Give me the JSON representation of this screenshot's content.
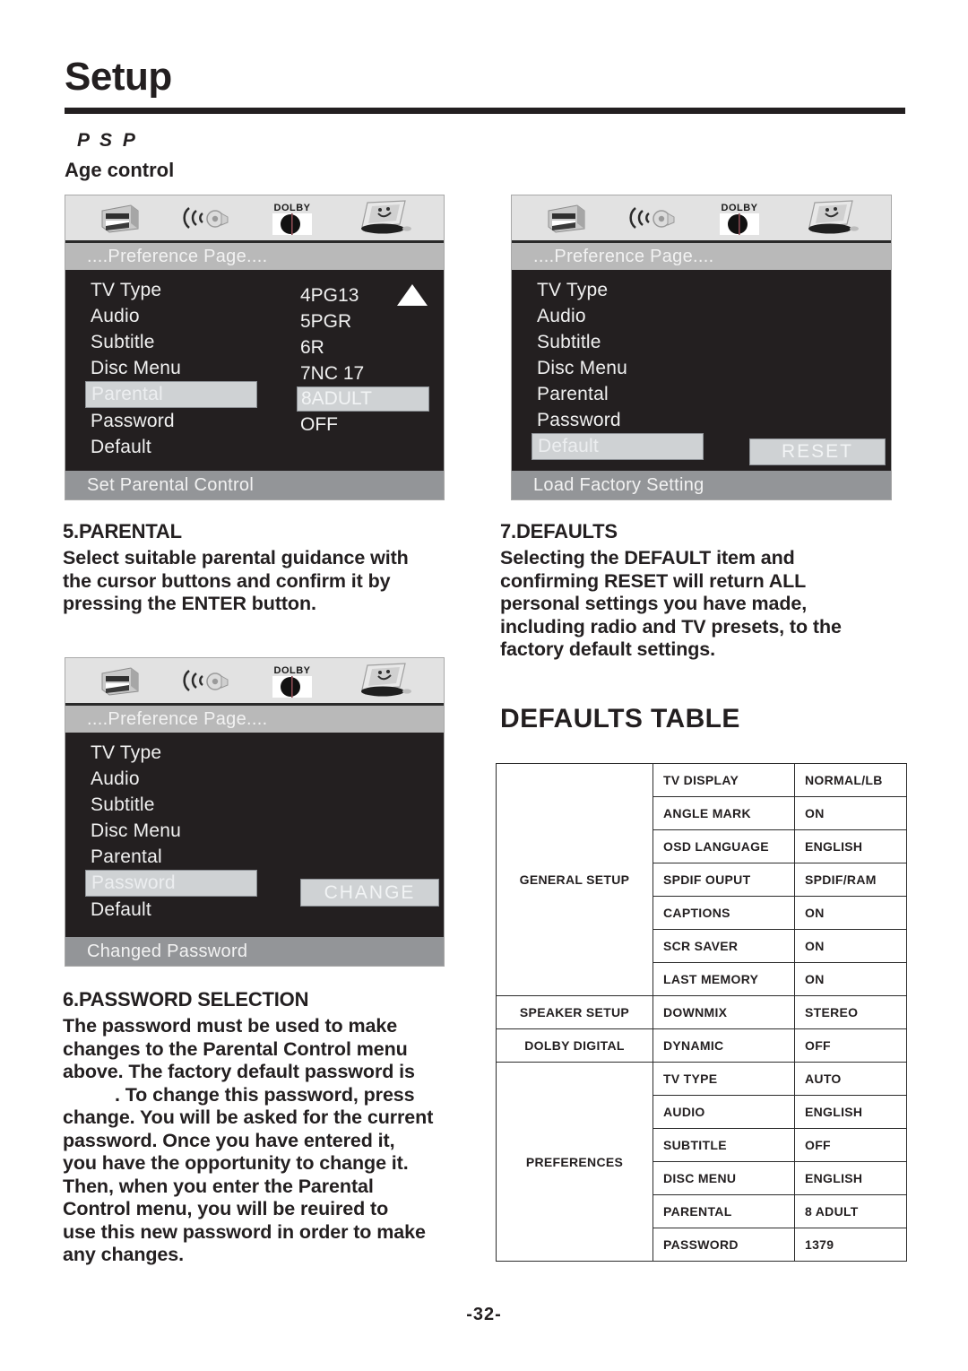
{
  "page": {
    "title": "Setup",
    "psp_label": "P S P",
    "subtitle": "Age control",
    "number": "-32-"
  },
  "osd_panels": [
    {
      "id": "parental-panel",
      "icons": [
        "disc-icon",
        "sound-wave-speaker-icon",
        "dolby-digital-icon",
        "tv-preference-icon"
      ],
      "page_title": "....Preference Page....",
      "menu_items": [
        "TV Type",
        "Audio",
        "Subtitle",
        "Disc Menu",
        "Parental",
        "Password",
        "Default"
      ],
      "selected_menu_item": "Parental",
      "values": [
        "4PG13",
        "5PGR",
        "6R",
        "7NC 17",
        "8ADULT",
        "OFF"
      ],
      "selected_value": "8ADULT",
      "scroll_arrow": "up-triangle-icon",
      "footer": "Set Parental Control"
    },
    {
      "id": "defaults-panel",
      "icons": [
        "disc-icon",
        "sound-wave-speaker-icon",
        "dolby-digital-icon",
        "tv-preference-icon"
      ],
      "page_title": "....Preference Page....",
      "menu_items": [
        "TV Type",
        "Audio",
        "Subtitle",
        "Disc Menu",
        "Parental",
        "Password",
        "Default"
      ],
      "selected_menu_item": "Default",
      "action_label": "RESET",
      "footer": "Load Factory Setting"
    },
    {
      "id": "password-panel",
      "icons": [
        "disc-icon",
        "sound-wave-speaker-icon",
        "dolby-digital-icon",
        "tv-preference-icon"
      ],
      "page_title": "....Preference Page....",
      "menu_items": [
        "TV Type",
        "Audio",
        "Subtitle",
        "Disc Menu",
        "Parental",
        "Password",
        "Default"
      ],
      "selected_menu_item": "Password",
      "action_label": "CHANGE",
      "footer": "Changed Password"
    }
  ],
  "sections": {
    "parental": {
      "heading": "5.PARENTAL",
      "lines": [
        "Select suitable parental guidance with",
        "the cursor buttons and confirm it  by",
        "pressing the ENTER button."
      ]
    },
    "defaults": {
      "heading": "7.DEFAULTS",
      "lines": [
        "Selecting the DEFAULT item and",
        "confirming RESET will return ALL",
        "personal settings you have made,",
        "including radio and TV presets, to the",
        "factory default settings."
      ]
    },
    "password": {
      "heading": "6.PASSWORD SELECTION",
      "lines": [
        "The password must be used to make",
        "changes to the Parental Control menu",
        "above. The factory default password is",
        ". To change this password, press",
        "change. You will be asked for the current",
        "password. Once you have entered it,",
        "you have the opportunity to change it.",
        "Then, when you enter the Parental",
        "Control menu, you will be reuired to",
        "use this new password in order to make",
        "any changes."
      ]
    }
  },
  "defaults_table": {
    "title": "DEFAULTS TABLE",
    "groups": [
      {
        "name": "GENERAL SETUP",
        "rows": [
          {
            "setting": "TV DISPLAY",
            "value": "NORMAL/LB"
          },
          {
            "setting": "ANGLE MARK",
            "value": "ON"
          },
          {
            "setting": "OSD LANGUAGE",
            "value": "ENGLISH"
          },
          {
            "setting": "SPDIF OUPUT",
            "value": "SPDIF/RAM"
          },
          {
            "setting": "CAPTIONS",
            "value": "ON"
          },
          {
            "setting": "SCR SAVER",
            "value": "ON"
          },
          {
            "setting": "LAST MEMORY",
            "value": "ON"
          }
        ]
      },
      {
        "name": "SPEAKER SETUP",
        "rows": [
          {
            "setting": "DOWNMIX",
            "value": "STEREO"
          }
        ]
      },
      {
        "name": "DOLBY DIGITAL",
        "rows": [
          {
            "setting": "DYNAMIC",
            "value": "OFF"
          }
        ]
      },
      {
        "name": "PREFERENCES",
        "rows": [
          {
            "setting": "TV TYPE",
            "value": "AUTO"
          },
          {
            "setting": "AUDIO",
            "value": "ENGLISH"
          },
          {
            "setting": "SUBTITLE",
            "value": "OFF"
          },
          {
            "setting": "DISC MENU",
            "value": "ENGLISH"
          },
          {
            "setting": "PARENTAL",
            "value": "8  ADULT"
          },
          {
            "setting": "PASSWORD",
            "value": "1379"
          }
        ]
      }
    ]
  },
  "colors": {
    "ink": "#231f20",
    "osd_bg": "#231f20",
    "osd_title_bar": "#b9b9b9",
    "osd_footer_bar": "#939598",
    "osd_highlight": "#cfd2d4",
    "icon_bar": "#e2e2e2"
  }
}
